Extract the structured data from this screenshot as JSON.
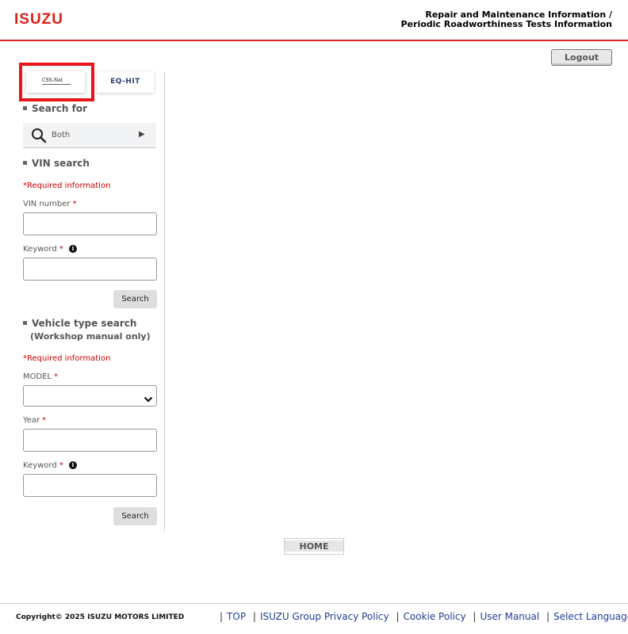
{
  "header": {
    "logo_text": "ISUZU",
    "title_line1": "Repair and Maintenance Information /",
    "title_line2": "Periodic Roadworthiness Tests Information"
  },
  "logout_label": "Logout",
  "tabs": {
    "css_net_label": "CSS-Net",
    "eq_hit_label": "EQ-HIT"
  },
  "search_for": {
    "title": "Search for",
    "value": "Both",
    "icons": {
      "search": "magnifier-icon",
      "expand": "triangle-right-icon"
    }
  },
  "vin_search": {
    "title": "VIN search",
    "required_note": "*Required information",
    "vin_label": "VIN number",
    "keyword_label": "Keyword",
    "required_mark": "*",
    "info_icon": "i",
    "search_label": "Search"
  },
  "vehicle_search": {
    "title": "Vehicle type search",
    "subtitle": "(Workshop manual only)",
    "required_note": "*Required information",
    "model_label": "MODEL",
    "year_label": "Year",
    "keyword_label": "Keyword",
    "required_mark": "*",
    "info_icon": "i",
    "search_label": "Search"
  },
  "home_label": "HOME",
  "footer": {
    "copyright": "Copyright© 2025 ISUZU MOTORS LIMITED",
    "separator": "|",
    "links": [
      "TOP",
      "ISUZU Group Privacy Policy",
      "Cookie Policy",
      "User Manual",
      "Select Language"
    ]
  },
  "colors": {
    "brand_red": "#d9221c",
    "highlight_red": "#e8141a",
    "required_red": "#cc0000",
    "link_blue": "#1f3f93"
  }
}
